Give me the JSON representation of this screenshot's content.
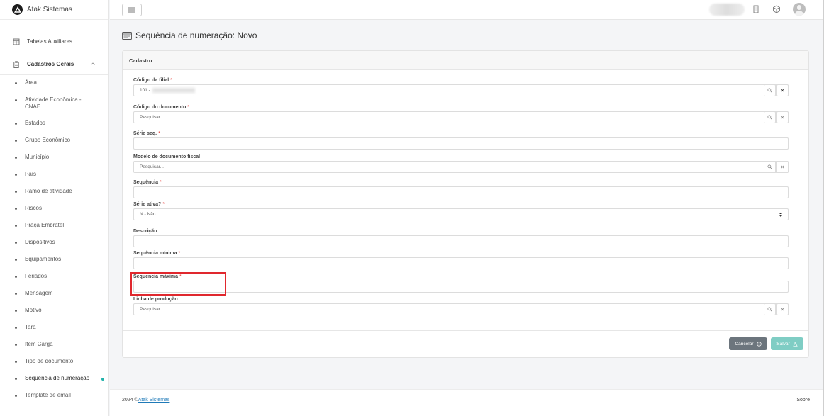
{
  "brand": {
    "name": "Atak Sistemas"
  },
  "sidebar": {
    "top_items": [
      {
        "label": "Tabelas Auxiliares"
      },
      {
        "label": "Cadastros Gerais"
      }
    ],
    "sub_items": [
      {
        "label": "Área"
      },
      {
        "label": "Atividade Econômica - CNAE"
      },
      {
        "label": "Estados"
      },
      {
        "label": "Grupo Econômico"
      },
      {
        "label": "Município"
      },
      {
        "label": "País"
      },
      {
        "label": "Ramo de atividade"
      },
      {
        "label": "Riscos"
      },
      {
        "label": "Praça Embratel"
      },
      {
        "label": "Dispositivos"
      },
      {
        "label": "Equipamentos"
      },
      {
        "label": "Feriados"
      },
      {
        "label": "Mensagem"
      },
      {
        "label": "Motivo"
      },
      {
        "label": "Tara"
      },
      {
        "label": "Item Carga"
      },
      {
        "label": "Tipo de documento"
      },
      {
        "label": "Sequência de numeração"
      },
      {
        "label": "Template de email"
      }
    ],
    "active_sub_item": "Sequência de numeração"
  },
  "page": {
    "title": "Sequência de numeração: Novo"
  },
  "card": {
    "header": "Cadastro",
    "fields": [
      {
        "label": "Código da filial",
        "required": "*",
        "value": "101 -",
        "placeholder": ""
      },
      {
        "label": "Código do documento",
        "required": "*",
        "value": "",
        "placeholder": "Pesquisar..."
      },
      {
        "label": "Série seq.",
        "required": "*",
        "value": "",
        "placeholder": ""
      },
      {
        "label": "Modelo de documento fiscal",
        "required": "",
        "value": "",
        "placeholder": "Pesquisar..."
      },
      {
        "label": "Sequência",
        "required": "*",
        "value": "",
        "placeholder": ""
      },
      {
        "label": "Série ativa?",
        "required": "*",
        "value": "N - Não",
        "placeholder": ""
      },
      {
        "label": "Descrição",
        "required": "",
        "value": "",
        "placeholder": ""
      },
      {
        "label": "Sequência mínima",
        "required": "*",
        "value": "",
        "placeholder": ""
      },
      {
        "label": "Sequencia máxima",
        "required": "*",
        "value": "",
        "placeholder": ""
      },
      {
        "label": "Linha de produção",
        "required": "",
        "value": "",
        "placeholder": "Pesquisar..."
      }
    ],
    "buttons": {
      "cancel": "Cancelar",
      "save": "Salvar"
    }
  },
  "footer": {
    "year": "2024 ©",
    "company_link": "Atak Sistemas",
    "about": "Sobre"
  },
  "colors": {
    "accent": "#20b2aa",
    "save_button": "#7fcdc4",
    "cancel_button": "#6c757d",
    "required": "#e53935",
    "highlight": "#e0282e"
  },
  "icons": {
    "brand": "atak-logo-icon",
    "tabelas": "table-icon",
    "cadastros": "clipboard-icon",
    "menu": "hamburger-icon",
    "building": "building-icon",
    "box": "cube-icon",
    "search": "search-icon",
    "clear": "close-icon"
  }
}
